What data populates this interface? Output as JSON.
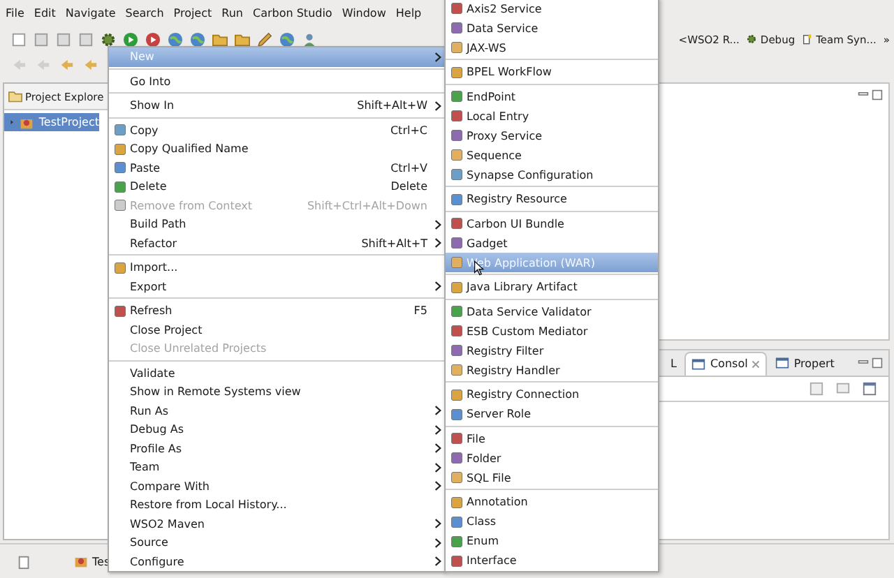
{
  "menubar": [
    "File",
    "Edit",
    "Navigate",
    "Search",
    "Project",
    "Run",
    "Carbon Studio",
    "Window",
    "Help"
  ],
  "perspectives": [
    {
      "label": "<WSO2 R..."
    },
    {
      "label": "Debug"
    },
    {
      "label": "Team Syn..."
    }
  ],
  "perspective_overflow": "»",
  "project_explorer": {
    "title": "Project Explore",
    "items": [
      {
        "label": "TestProject",
        "selected": true,
        "expanded": false
      }
    ]
  },
  "bottom_panel": {
    "tabs": [
      {
        "label": "L",
        "selected": false
      },
      {
        "label": "Consol",
        "selected": true
      },
      {
        "label": "Propert",
        "selected": false
      }
    ]
  },
  "status_bar": {
    "task": "Tes"
  },
  "context_menu": {
    "items": [
      {
        "kind": "item",
        "label": "New",
        "selected": true,
        "disabled": false,
        "icon": false,
        "submenu": true
      },
      {
        "kind": "separator"
      },
      {
        "kind": "item",
        "label": "Go Into",
        "selected": false,
        "disabled": false,
        "icon": false,
        "submenu": false
      },
      {
        "kind": "separator"
      },
      {
        "kind": "item",
        "label": "Show In",
        "shortcut": "Shift+Alt+W",
        "selected": false,
        "disabled": false,
        "icon": false,
        "submenu": true
      },
      {
        "kind": "separator"
      },
      {
        "kind": "item",
        "label": "Copy",
        "shortcut": "Ctrl+C",
        "selected": false,
        "disabled": false,
        "icon": true,
        "submenu": false
      },
      {
        "kind": "item",
        "label": "Copy Qualified Name",
        "selected": false,
        "disabled": false,
        "icon": true,
        "submenu": false
      },
      {
        "kind": "item",
        "label": "Paste",
        "shortcut": "Ctrl+V",
        "selected": false,
        "disabled": false,
        "icon": true,
        "submenu": false
      },
      {
        "kind": "item",
        "label": "Delete",
        "shortcut": "Delete",
        "selected": false,
        "disabled": false,
        "icon": true,
        "submenu": false
      },
      {
        "kind": "item",
        "label": "Remove from Context",
        "shortcut": "Shift+Ctrl+Alt+Down",
        "selected": false,
        "disabled": true,
        "icon": true,
        "submenu": false
      },
      {
        "kind": "item",
        "label": "Build Path",
        "selected": false,
        "disabled": false,
        "icon": false,
        "submenu": true
      },
      {
        "kind": "item",
        "label": "Refactor",
        "shortcut": "Shift+Alt+T",
        "selected": false,
        "disabled": false,
        "icon": false,
        "submenu": true
      },
      {
        "kind": "separator"
      },
      {
        "kind": "item",
        "label": "Import...",
        "selected": false,
        "disabled": false,
        "icon": true,
        "submenu": false
      },
      {
        "kind": "item",
        "label": "Export",
        "selected": false,
        "disabled": false,
        "icon": false,
        "submenu": true
      },
      {
        "kind": "separator"
      },
      {
        "kind": "item",
        "label": "Refresh",
        "shortcut": "F5",
        "selected": false,
        "disabled": false,
        "icon": true,
        "submenu": false
      },
      {
        "kind": "item",
        "label": "Close Project",
        "selected": false,
        "disabled": false,
        "icon": false,
        "submenu": false
      },
      {
        "kind": "item",
        "label": "Close Unrelated Projects",
        "selected": false,
        "disabled": true,
        "icon": false,
        "submenu": false
      },
      {
        "kind": "separator"
      },
      {
        "kind": "item",
        "label": "Validate",
        "selected": false,
        "disabled": false,
        "icon": false,
        "submenu": false
      },
      {
        "kind": "item",
        "label": "Show in Remote Systems view",
        "selected": false,
        "disabled": false,
        "icon": false,
        "submenu": false
      },
      {
        "kind": "item",
        "label": "Run As",
        "selected": false,
        "disabled": false,
        "icon": false,
        "submenu": true
      },
      {
        "kind": "item",
        "label": "Debug As",
        "selected": false,
        "disabled": false,
        "icon": false,
        "submenu": true
      },
      {
        "kind": "item",
        "label": "Profile As",
        "selected": false,
        "disabled": false,
        "icon": false,
        "submenu": true
      },
      {
        "kind": "item",
        "label": "Team",
        "selected": false,
        "disabled": false,
        "icon": false,
        "submenu": true
      },
      {
        "kind": "item",
        "label": "Compare With",
        "selected": false,
        "disabled": false,
        "icon": false,
        "submenu": true
      },
      {
        "kind": "item",
        "label": "Restore from Local History...",
        "selected": false,
        "disabled": false,
        "icon": false,
        "submenu": false
      },
      {
        "kind": "item",
        "label": "WSO2 Maven",
        "selected": false,
        "disabled": false,
        "icon": false,
        "submenu": true
      },
      {
        "kind": "item",
        "label": "Source",
        "selected": false,
        "disabled": false,
        "icon": false,
        "submenu": true
      },
      {
        "kind": "item",
        "label": "Configure",
        "selected": false,
        "disabled": false,
        "icon": false,
        "submenu": true
      }
    ]
  },
  "submenu": {
    "items": [
      {
        "kind": "item",
        "label": "Axis2 Service",
        "selected": false
      },
      {
        "kind": "item",
        "label": "Data Service",
        "selected": false
      },
      {
        "kind": "item",
        "label": "JAX-WS",
        "selected": false
      },
      {
        "kind": "separator"
      },
      {
        "kind": "item",
        "label": "BPEL WorkFlow",
        "selected": false
      },
      {
        "kind": "separator"
      },
      {
        "kind": "item",
        "label": "EndPoint",
        "selected": false
      },
      {
        "kind": "item",
        "label": "Local Entry",
        "selected": false
      },
      {
        "kind": "item",
        "label": "Proxy Service",
        "selected": false
      },
      {
        "kind": "item",
        "label": "Sequence",
        "selected": false
      },
      {
        "kind": "item",
        "label": "Synapse Configuration",
        "selected": false
      },
      {
        "kind": "separator"
      },
      {
        "kind": "item",
        "label": "Registry Resource",
        "selected": false
      },
      {
        "kind": "separator"
      },
      {
        "kind": "item",
        "label": "Carbon UI Bundle",
        "selected": false
      },
      {
        "kind": "item",
        "label": "Gadget",
        "selected": false
      },
      {
        "kind": "item",
        "label": "Web Application (WAR)",
        "selected": true
      },
      {
        "kind": "separator"
      },
      {
        "kind": "item",
        "label": "Java Library Artifact",
        "selected": false
      },
      {
        "kind": "separator"
      },
      {
        "kind": "item",
        "label": "Data Service Validator",
        "selected": false
      },
      {
        "kind": "item",
        "label": "ESB Custom Mediator",
        "selected": false
      },
      {
        "kind": "item",
        "label": "Registry Filter",
        "selected": false
      },
      {
        "kind": "item",
        "label": "Registry Handler",
        "selected": false
      },
      {
        "kind": "separator"
      },
      {
        "kind": "item",
        "label": "Registry Connection",
        "selected": false
      },
      {
        "kind": "item",
        "label": "Server Role",
        "selected": false
      },
      {
        "kind": "separator"
      },
      {
        "kind": "item",
        "label": "File",
        "selected": false
      },
      {
        "kind": "item",
        "label": "Folder",
        "selected": false
      },
      {
        "kind": "item",
        "label": "SQL File",
        "selected": false
      },
      {
        "kind": "separator"
      },
      {
        "kind": "item",
        "label": "Annotation",
        "selected": false
      },
      {
        "kind": "item",
        "label": "Class",
        "selected": false
      },
      {
        "kind": "item",
        "label": "Enum",
        "selected": false
      },
      {
        "kind": "item",
        "label": "Interface",
        "selected": false
      }
    ]
  }
}
